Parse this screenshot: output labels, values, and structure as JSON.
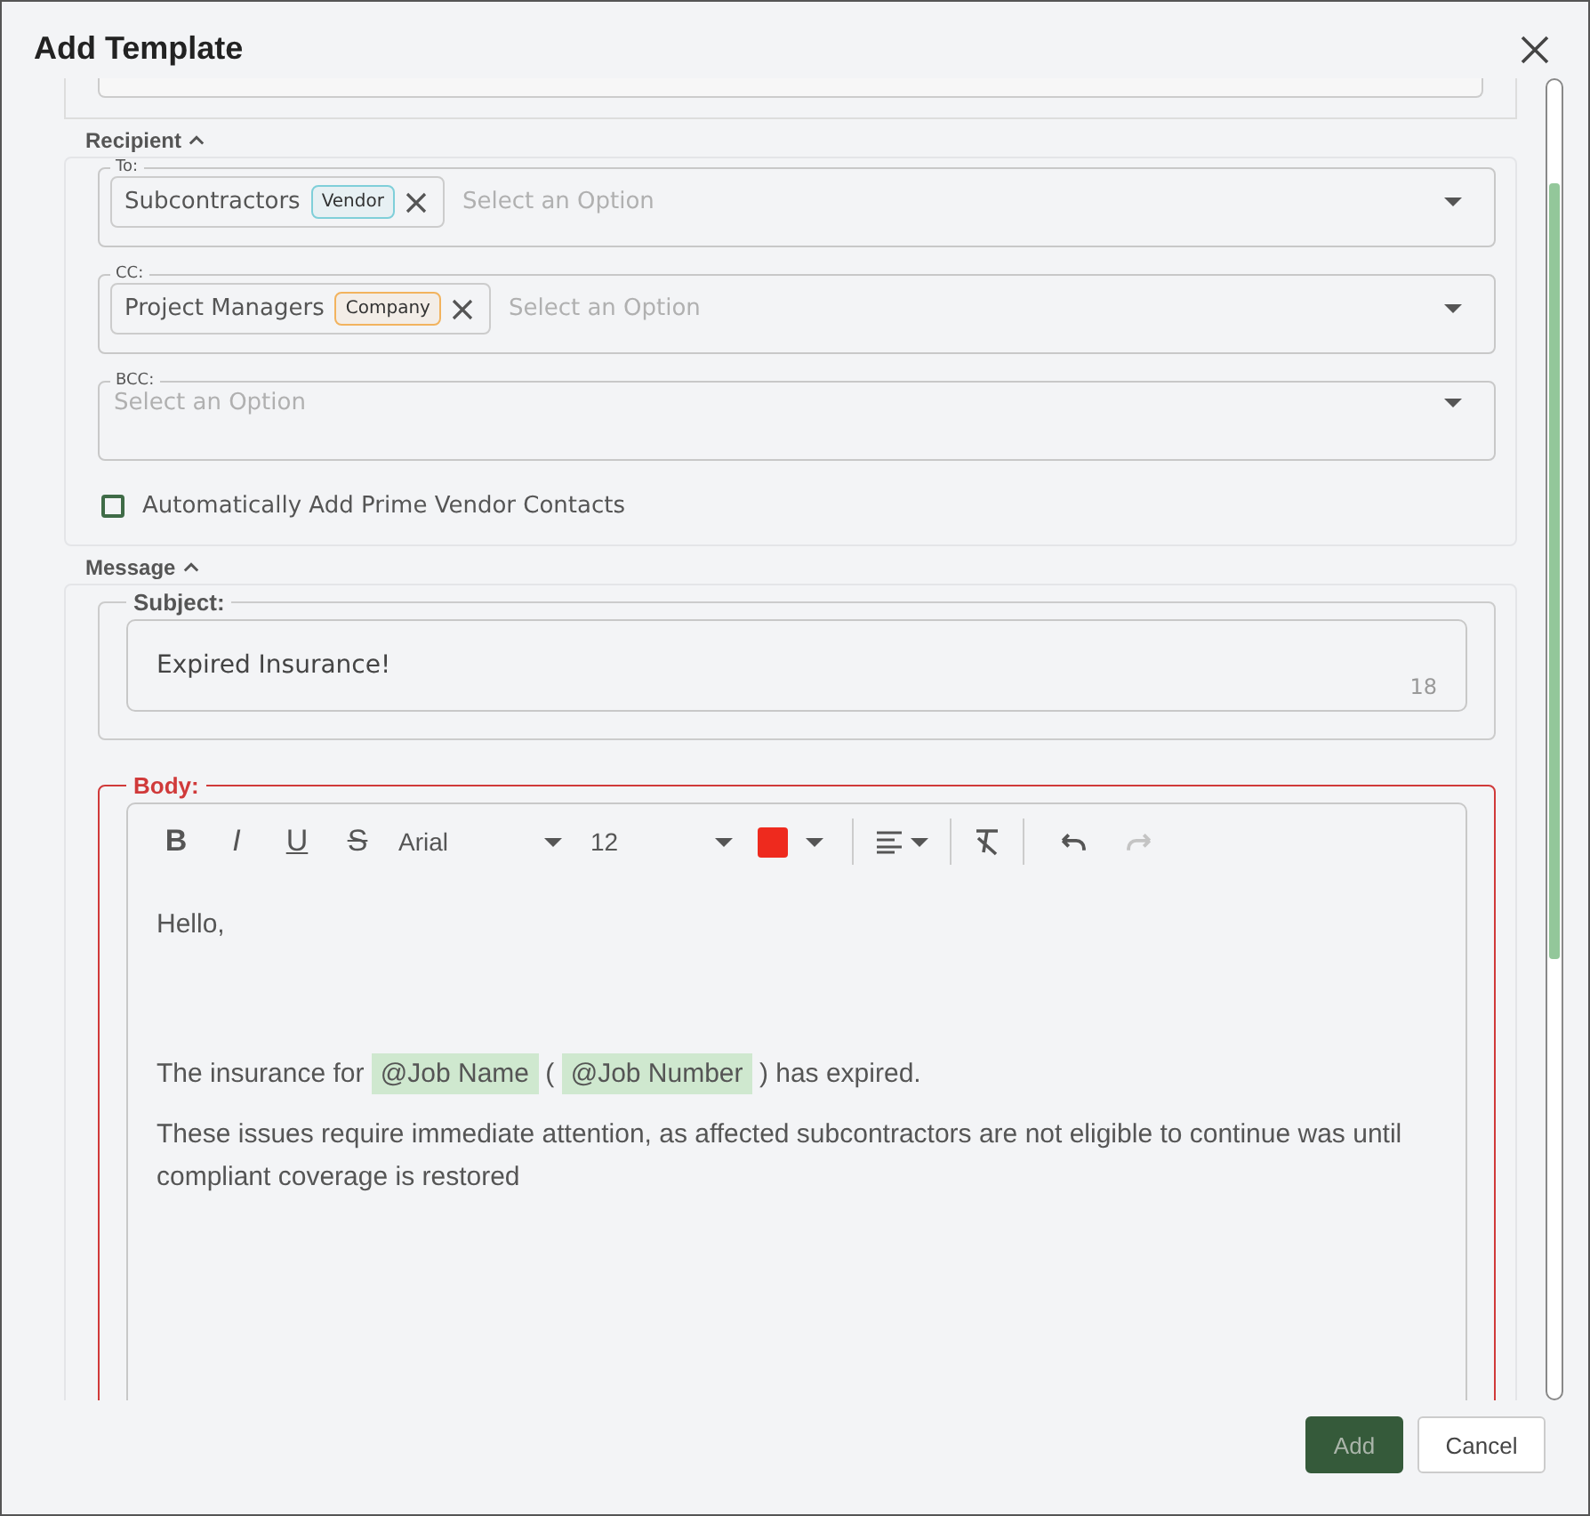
{
  "window": {
    "title": "Add Template"
  },
  "recipient": {
    "title": "Recipient",
    "expanded": true,
    "fields": [
      {
        "label": "To:",
        "chips": [
          {
            "text": "Subcontractors",
            "tag": "Vendor",
            "color": "#7fcfd9"
          }
        ],
        "placeholder": "Select an Option"
      },
      {
        "label": "CC:",
        "chips": [
          {
            "text": "Project Managers",
            "tag": "Company",
            "color": "#f2b35e"
          }
        ],
        "placeholder": "Select an Option"
      },
      {
        "label": "BCC:",
        "placeholder": "Select an Option"
      }
    ],
    "checkbox": {
      "label": "Automatically Add Prime Vendor Contacts",
      "checked": false
    }
  },
  "message": {
    "title": "Message",
    "expanded": true,
    "subject": {
      "label": "Subject:",
      "value": "Expired Insurance!",
      "count": "18"
    },
    "body": {
      "label": "Body:",
      "error": true,
      "toolbar": [
        {
          "kind": "bold",
          "glyph": "B"
        },
        {
          "kind": "italic",
          "glyph": "I"
        },
        {
          "kind": "underline",
          "glyph": "U"
        },
        {
          "kind": "strike",
          "glyph": "S"
        },
        {
          "kind": "font",
          "value": "Arial"
        },
        {
          "kind": "size",
          "value": "12"
        },
        {
          "kind": "color",
          "color": "#ee2a1e"
        },
        {
          "kind": "divider"
        },
        {
          "kind": "align"
        },
        {
          "kind": "divider"
        },
        {
          "kind": "clear"
        },
        {
          "kind": "divider"
        },
        {
          "kind": "undo",
          "disabled": false
        },
        {
          "kind": "redo",
          "disabled": true
        }
      ],
      "paragraphs": [
        {
          "kind": "text",
          "spans": [
            {
              "text": "Hello,"
            }
          ]
        },
        {
          "kind": "blank"
        },
        {
          "kind": "text",
          "spans": [
            {
              "text": "The insurance for "
            },
            {
              "mention": "@Job Name"
            },
            {
              "text": " ( "
            },
            {
              "mention": "@Job Number"
            },
            {
              "text": " ) has expired."
            }
          ]
        },
        {
          "kind": "text",
          "spans": [
            {
              "text": "These issues require immediate attention, as affected subcontractors are not eligible to continue was until compliant coverage is restored"
            }
          ]
        }
      ]
    }
  },
  "buttons": [
    {
      "label": "Add",
      "kind": "primary"
    },
    {
      "label": "Cancel",
      "kind": "secondary"
    }
  ]
}
